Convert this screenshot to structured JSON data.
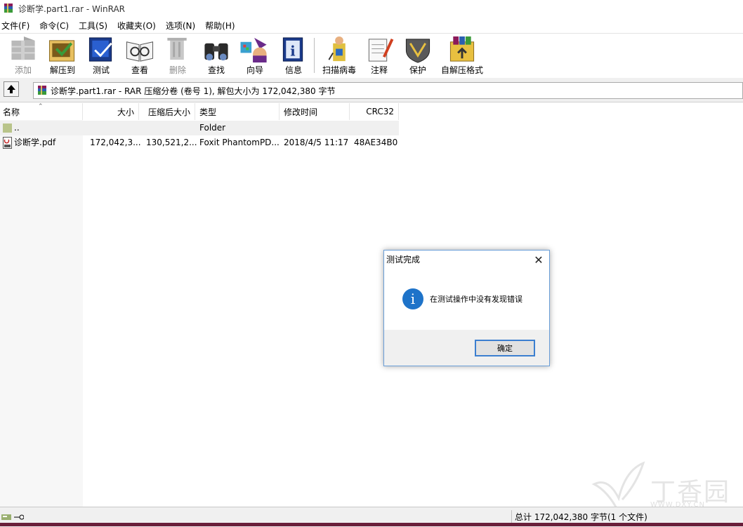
{
  "window": {
    "title": "诊断学.part1.rar - WinRAR"
  },
  "menu": [
    "文件(F)",
    "命令(C)",
    "工具(S)",
    "收藏夹(O)",
    "选项(N)",
    "帮助(H)"
  ],
  "toolbar": {
    "add": "添加",
    "extract": "解压到",
    "test": "测试",
    "view": "查看",
    "delete": "删除",
    "find": "查找",
    "wizard": "向导",
    "info": "信息",
    "virus": "扫描病毒",
    "comment": "注释",
    "protect": "保护",
    "sfx": "自解压格式"
  },
  "address": {
    "text": "诊断学.part1.rar - RAR 压缩分卷 (卷号 1), 解包大小为 172,042,380 字节"
  },
  "columns": {
    "name": "名称",
    "size": "大小",
    "packed": "压缩后大小",
    "type": "类型",
    "modified": "修改时间",
    "crc": "CRC32"
  },
  "files": [
    {
      "name": "..",
      "size": "",
      "packed": "",
      "type": "Folder",
      "modified": "",
      "crc": ""
    },
    {
      "name": "诊断学.pdf",
      "size": "172,042,3...",
      "packed": "130,521,2...",
      "type": "Foxit PhantomPD...",
      "modified": "2018/4/5 11:17",
      "crc": "48AE34B0"
    }
  ],
  "status": {
    "summary": "总计 172,042,380 字节(1 个文件)"
  },
  "dialog": {
    "title": "测试完成",
    "message": "在测试操作中没有发现错误",
    "ok": "确定"
  },
  "watermark": {
    "text": "丁香园",
    "url": "WWW.DXY.CN"
  },
  "colors": {
    "dialog_border": "#6a9ed8",
    "info_icon": "#1e73c9",
    "ok_border": "#3c7fd0"
  }
}
